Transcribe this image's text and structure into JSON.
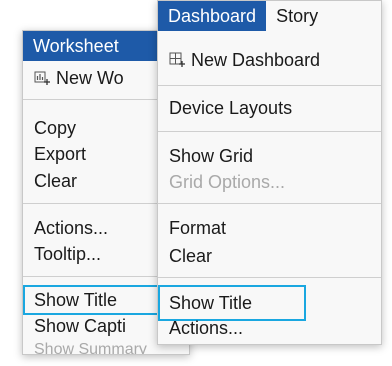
{
  "worksheet_menu": {
    "title": "Worksheet",
    "items": [
      {
        "label": "New Wo",
        "icon": "new-worksheet-icon"
      },
      {
        "label": "Copy"
      },
      {
        "label": "Export"
      },
      {
        "label": "Clear"
      },
      {
        "label": "Actions..."
      },
      {
        "label": "Tooltip..."
      },
      {
        "label": "Show Title"
      },
      {
        "label": "Show Capti"
      },
      {
        "label": "Show Summary"
      }
    ]
  },
  "dashboard_menu": {
    "tabs": [
      {
        "label": "Dashboard",
        "active": true
      },
      {
        "label": "Story",
        "active": false
      }
    ],
    "items": [
      {
        "label": "New Dashboard",
        "icon": "new-dashboard-icon"
      },
      {
        "label": "Device Layouts"
      },
      {
        "label": "Show Grid"
      },
      {
        "label": "Grid Options..."
      },
      {
        "label": "Format"
      },
      {
        "label": "Clear"
      },
      {
        "label": "Show Title"
      },
      {
        "label": "Actions..."
      }
    ]
  },
  "colors": {
    "active_tab": "#1e5aa8",
    "highlight_outline": "#1aa7e0",
    "disabled_text": "#a9a9a9"
  }
}
